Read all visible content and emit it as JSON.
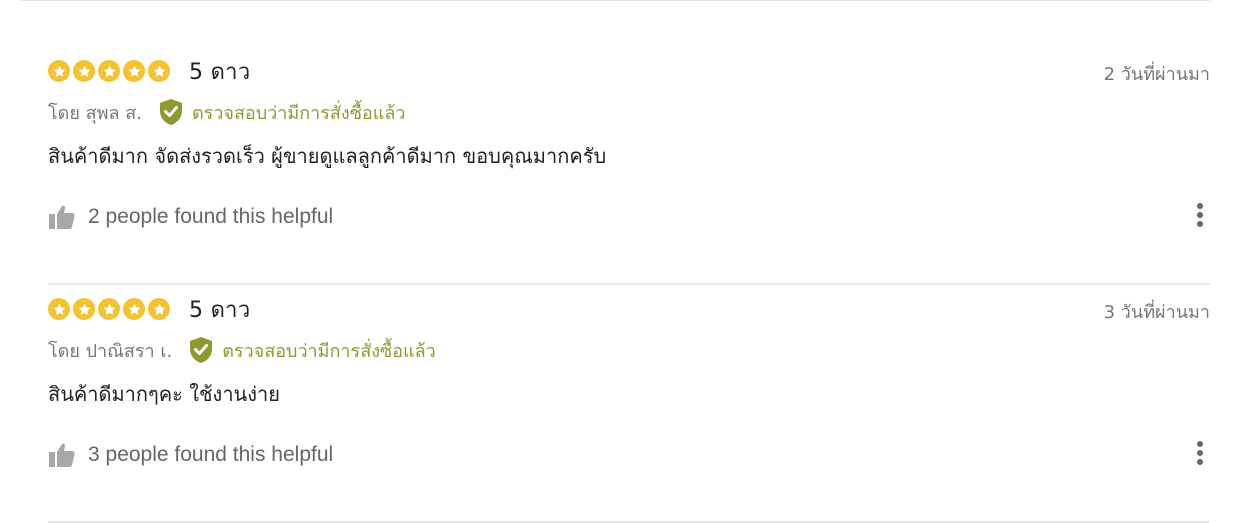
{
  "reviews": [
    {
      "stars": 5,
      "rating_label": "5 ดาว",
      "date": "2 วันที่ผ่านมา",
      "author": "โดย สุพล ส.",
      "verified_label": "ตรวจสอบว่ามีการสั่งซื้อแล้ว",
      "text": "สินค้าดีมาก จัดส่งรวดเร็ว ผู้ขายดูแลลูกค้าดีมาก ขอบคุณมากครับ",
      "helpful_text": "2 people found this helpful"
    },
    {
      "stars": 5,
      "rating_label": "5 ดาว",
      "date": "3 วันที่ผ่านมา",
      "author": "โดย ปาณิสรา เ.",
      "verified_label": "ตรวจสอบว่ามีการสั่งซื้อแล้ว",
      "text": "สินค้าดีมากๆคะ ใช้งานง่าย",
      "helpful_text": "3 people found this helpful"
    }
  ],
  "icons": {
    "star": "star-icon",
    "verified": "shield-check-icon",
    "helpful": "thumbs-up-icon",
    "more": "more-vertical-icon"
  },
  "colors": {
    "star": "#f5c330",
    "verified": "#8f9a2e",
    "muted_text": "#777777",
    "helpful_icon": "#a8a8a8",
    "divider": "#e8e8e8"
  }
}
